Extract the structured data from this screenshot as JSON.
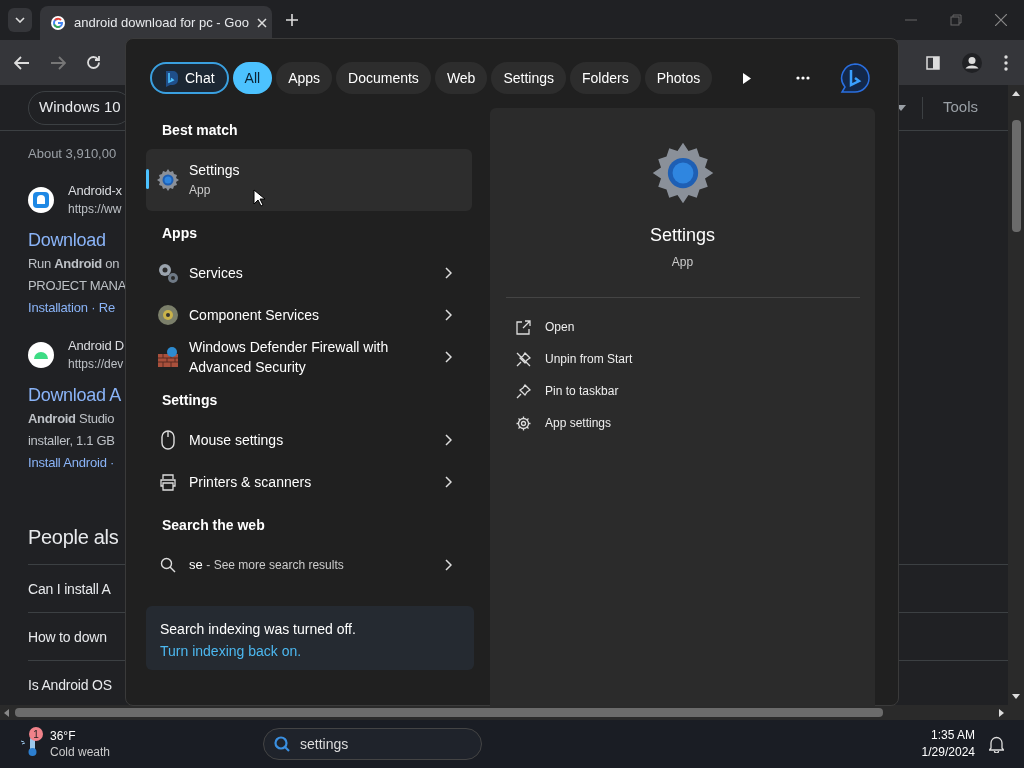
{
  "browser": {
    "tabs": [
      {
        "title": "android download for pc - Goo",
        "selected": true
      }
    ],
    "results_nav": {
      "chip": "Windows 10",
      "tools": "Tools"
    },
    "result_count": "About 3,910,00",
    "results": [
      {
        "kind": "app",
        "site": "Android-x",
        "url": "https://ww",
        "title": "Download",
        "snippet": [
          "Run **Android** on",
          "PROJECT MANA"
        ],
        "links": "Installation · Re"
      },
      {
        "kind": "android",
        "site": "Android D",
        "url": "https://dev",
        "title": "Download A",
        "snippet": [
          "**Android** Studio",
          "installer, 1.1 GB"
        ],
        "links": "Install Android ·"
      }
    ],
    "people_also_ask": {
      "heading": "People als",
      "questions": [
        "Can I install A",
        "How to down",
        "Is Android OS"
      ]
    }
  },
  "search_flyout": {
    "filters": [
      {
        "kind": "chat",
        "label": "Chat",
        "selected": false
      },
      {
        "kind": "text",
        "label": "All",
        "selected": true
      },
      {
        "kind": "text",
        "label": "Apps",
        "selected": false
      },
      {
        "kind": "text",
        "label": "Documents",
        "selected": false
      },
      {
        "kind": "text",
        "label": "Web",
        "selected": false
      },
      {
        "kind": "text",
        "label": "Settings",
        "selected": false
      },
      {
        "kind": "text",
        "label": "Folders",
        "selected": false
      },
      {
        "kind": "text",
        "label": "Photos",
        "selected": false
      }
    ],
    "sections": [
      {
        "heading": "Best match",
        "items": [
          {
            "kind": "gear",
            "title": "Settings",
            "subtitle": "App",
            "selected": true
          }
        ]
      },
      {
        "heading": "Apps",
        "items": [
          {
            "kind": "gears",
            "title": "Services",
            "selected": false
          },
          {
            "kind": "component",
            "title": "Component Services",
            "selected": false
          },
          {
            "kind": "firewall",
            "title": "Windows Defender Firewall with Advanced Security",
            "selected": false
          }
        ]
      },
      {
        "heading": "Settings",
        "items": [
          {
            "kind": "mouse",
            "title": "Mouse settings",
            "selected": false
          },
          {
            "kind": "printer",
            "title": "Printers & scanners",
            "selected": false
          }
        ]
      },
      {
        "heading": "Search the web",
        "items": [
          {
            "kind": "web",
            "title": "se",
            "hint": "- See more search results",
            "selected": false
          }
        ]
      }
    ],
    "notice": {
      "text": "Search indexing was turned off.",
      "link": "Turn indexing back on."
    },
    "preview": {
      "title": "Settings",
      "subtitle": "App",
      "actions": [
        {
          "kind": "open",
          "label": "Open"
        },
        {
          "kind": "unpin",
          "label": "Unpin from Start"
        },
        {
          "kind": "pin",
          "label": "Pin to taskbar"
        },
        {
          "kind": "settings",
          "label": "App settings"
        }
      ]
    }
  },
  "taskbar": {
    "weather": {
      "badge": "1",
      "temperature": "36°F",
      "condition": "Cold weath"
    },
    "search": {
      "value": "settings"
    },
    "time": "1:35 AM",
    "date": "1/29/2024"
  }
}
